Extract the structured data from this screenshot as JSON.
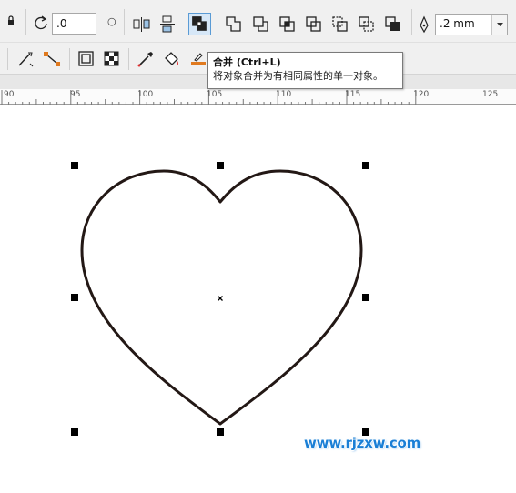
{
  "toolbar": {
    "angle_value": ".0",
    "outline_width": ".2 mm"
  },
  "tooltip": {
    "title": "合并 (Ctrl+L)",
    "description": "将对象合并为有相同属性的单一对象。"
  },
  "ruler": {
    "labels": [
      "90",
      "95",
      "100",
      "105",
      "110",
      "115",
      "120",
      "125"
    ]
  },
  "watermark": "www.rjzxw.com",
  "colors": {
    "accent": "#5a9bd5",
    "watermark": "#1a7fd6",
    "outline": "#231815"
  }
}
